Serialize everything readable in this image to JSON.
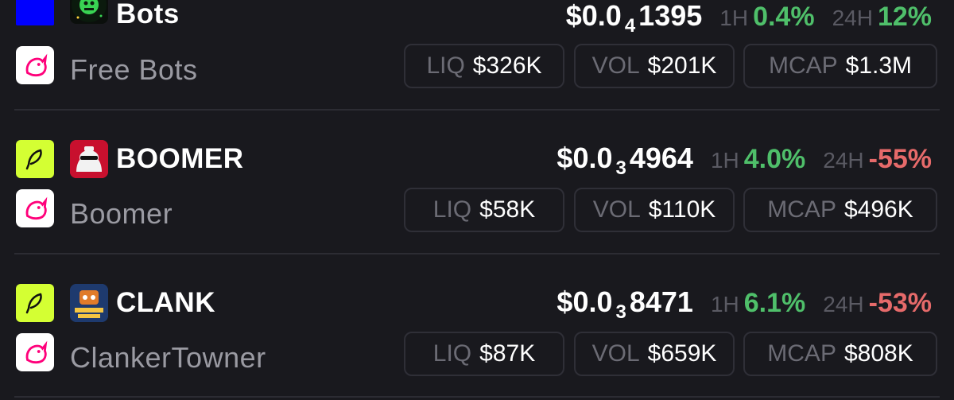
{
  "tokens": [
    {
      "symbol": "Bots",
      "name": "Free Bots",
      "price": {
        "prefix": "$0.0",
        "zeros": "4",
        "digits": "1395"
      },
      "h1_label": "1H",
      "h1_change": "0.4%",
      "h24_label": "24H",
      "h24_change": "12%",
      "liq": {
        "label": "LIQ",
        "value": "$326K"
      },
      "vol": {
        "label": "VOL",
        "value": "$201K"
      },
      "mcap": {
        "label": "MCAP",
        "value": "$1.3M"
      },
      "chain_icon": "blue-square-icon",
      "dex_icon": "uniswap-unicorn-icon"
    },
    {
      "symbol": "BOOMER",
      "name": "Boomer",
      "price": {
        "prefix": "$0.0",
        "zeros": "3",
        "digits": "4964"
      },
      "h1_label": "1H",
      "h1_change": "4.0%",
      "h24_label": "24H",
      "h24_change": "-55%",
      "liq": {
        "label": "LIQ",
        "value": "$58K"
      },
      "vol": {
        "label": "VOL",
        "value": "$110K"
      },
      "mcap": {
        "label": "MCAP",
        "value": "$496K"
      },
      "chain_icon": "feather-icon",
      "dex_icon": "uniswap-unicorn-icon"
    },
    {
      "symbol": "CLANK",
      "name": "ClankerTowner",
      "price": {
        "prefix": "$0.0",
        "zeros": "3",
        "digits": "8471"
      },
      "h1_label": "1H",
      "h1_change": "6.1%",
      "h24_label": "24H",
      "h24_change": "-53%",
      "liq": {
        "label": "LIQ",
        "value": "$87K"
      },
      "vol": {
        "label": "VOL",
        "value": "$659K"
      },
      "mcap": {
        "label": "MCAP",
        "value": "$808K"
      },
      "chain_icon": "feather-icon",
      "dex_icon": "uniswap-unicorn-icon"
    }
  ],
  "colors": {
    "background": "#19191e",
    "positive": "#4fbf6a",
    "negative": "#e66a6a",
    "chain_blue": "#0000ff",
    "chain_lime": "#d4ff33",
    "uniswap_pink": "#ff007a"
  }
}
